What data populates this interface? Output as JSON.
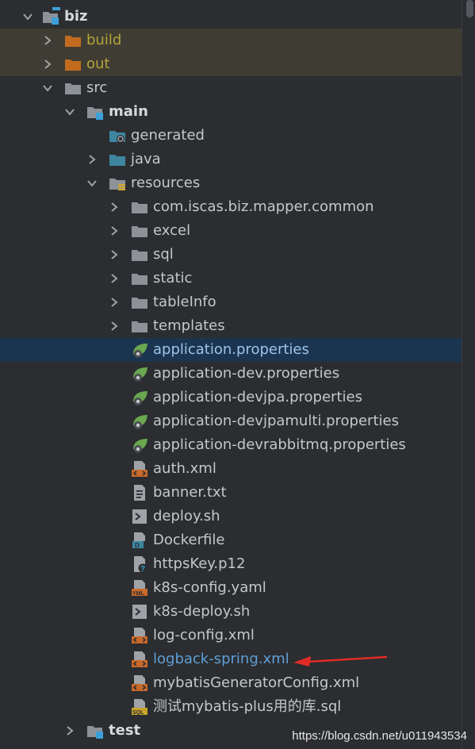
{
  "tree": {
    "items": [
      {
        "label": "biz",
        "kind": "module"
      },
      {
        "label": "build",
        "kind": "excluded-folder"
      },
      {
        "label": "out",
        "kind": "excluded-folder"
      },
      {
        "label": "src",
        "kind": "folder"
      },
      {
        "label": "main",
        "kind": "module-folder"
      },
      {
        "label": "generated",
        "kind": "generated-folder"
      },
      {
        "label": "java",
        "kind": "source-folder"
      },
      {
        "label": "resources",
        "kind": "resources-folder"
      },
      {
        "label": "com.iscas.biz.mapper.common",
        "kind": "folder"
      },
      {
        "label": "excel",
        "kind": "folder"
      },
      {
        "label": "sql",
        "kind": "folder"
      },
      {
        "label": "static",
        "kind": "folder"
      },
      {
        "label": "tableInfo",
        "kind": "folder"
      },
      {
        "label": "templates",
        "kind": "folder"
      },
      {
        "label": "application.properties",
        "kind": "spring-properties"
      },
      {
        "label": "application-dev.properties",
        "kind": "spring-properties"
      },
      {
        "label": "application-devjpa.properties",
        "kind": "spring-properties"
      },
      {
        "label": "application-devjpamulti.properties",
        "kind": "spring-properties"
      },
      {
        "label": "application-devrabbitmq.properties",
        "kind": "spring-properties"
      },
      {
        "label": "auth.xml",
        "kind": "xml-file"
      },
      {
        "label": "banner.txt",
        "kind": "text-file"
      },
      {
        "label": "deploy.sh",
        "kind": "shell-file"
      },
      {
        "label": "Dockerfile",
        "kind": "docker-file"
      },
      {
        "label": "httpsKey.p12",
        "kind": "unknown-file"
      },
      {
        "label": "k8s-config.yaml",
        "kind": "yaml-file"
      },
      {
        "label": "k8s-deploy.sh",
        "kind": "shell-file"
      },
      {
        "label": "log-config.xml",
        "kind": "xml-file"
      },
      {
        "label": "logback-spring.xml",
        "kind": "xml-file"
      },
      {
        "label": "mybatisGeneratorConfig.xml",
        "kind": "xml-file"
      },
      {
        "label": "测试mybatis-plus用的库.sql",
        "kind": "sql-file"
      },
      {
        "label": "test",
        "kind": "module-folder"
      }
    ],
    "selected_item": "application.properties",
    "annotated_item": "logback-spring.xml"
  },
  "watermark": "https://blog.csdn.net/u011943534",
  "colors": {
    "background": "#2b2d30",
    "excluded_row": "#3f3d33",
    "selected_row": "#1b3550",
    "excluded_text": "#b7a33b",
    "folder": "#8c9298",
    "excluded_folder": "#c26b1e",
    "source_folder": "#3e86a0",
    "spring_leaf": "#6aa84f",
    "xml_badge": "#c9692a",
    "arrow": "#e02b25"
  }
}
